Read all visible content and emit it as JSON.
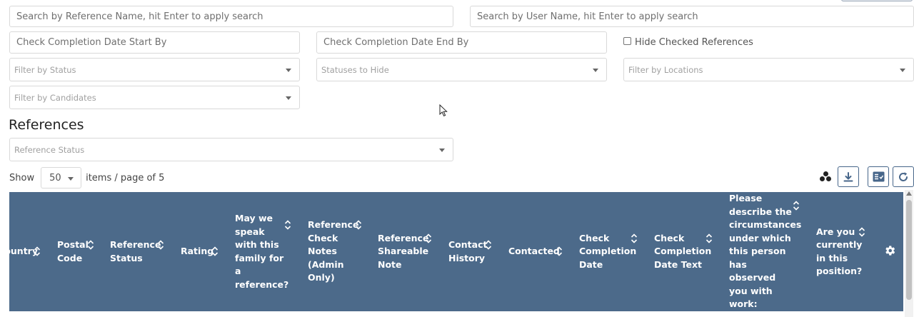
{
  "filters": {
    "search_reference_placeholder": "Search by Reference Name, hit Enter to apply search",
    "search_user_placeholder": "Search by User Name, hit Enter to apply search",
    "completion_start_placeholder": "Check Completion Date Start By",
    "completion_end_placeholder": "Check Completion Date End By",
    "hide_checked_label": "Hide Checked References",
    "status_placeholder": "Filter by Status",
    "statuses_hide_placeholder": "Statuses to Hide",
    "locations_placeholder": "Filter by Locations",
    "candidates_placeholder": "Filter by Candidates"
  },
  "section": {
    "title": "References",
    "reference_status_placeholder": "Reference Status"
  },
  "pagination": {
    "show_label": "Show",
    "page_size": "50",
    "suffix": "items / page of 5"
  },
  "table": {
    "columns": [
      {
        "label": "Country"
      },
      {
        "label": "Postal Code"
      },
      {
        "label": "Reference Status"
      },
      {
        "label": "Rating"
      },
      {
        "label": "May we speak with this family for a reference?"
      },
      {
        "label": "Reference Check Notes (Admin Only)"
      },
      {
        "label": "Reference Shareable Note"
      },
      {
        "label": "Contact History"
      },
      {
        "label": "Contacted"
      },
      {
        "label": "Check Completion Date"
      },
      {
        "label": "Check Completion Date Text"
      },
      {
        "label": "Please describe the circumstances under which this person has observed you with work:"
      },
      {
        "label": "Are you currently in this position?"
      }
    ]
  },
  "colors": {
    "header_bg": "#4c6a8a",
    "accent": "#47668a"
  }
}
